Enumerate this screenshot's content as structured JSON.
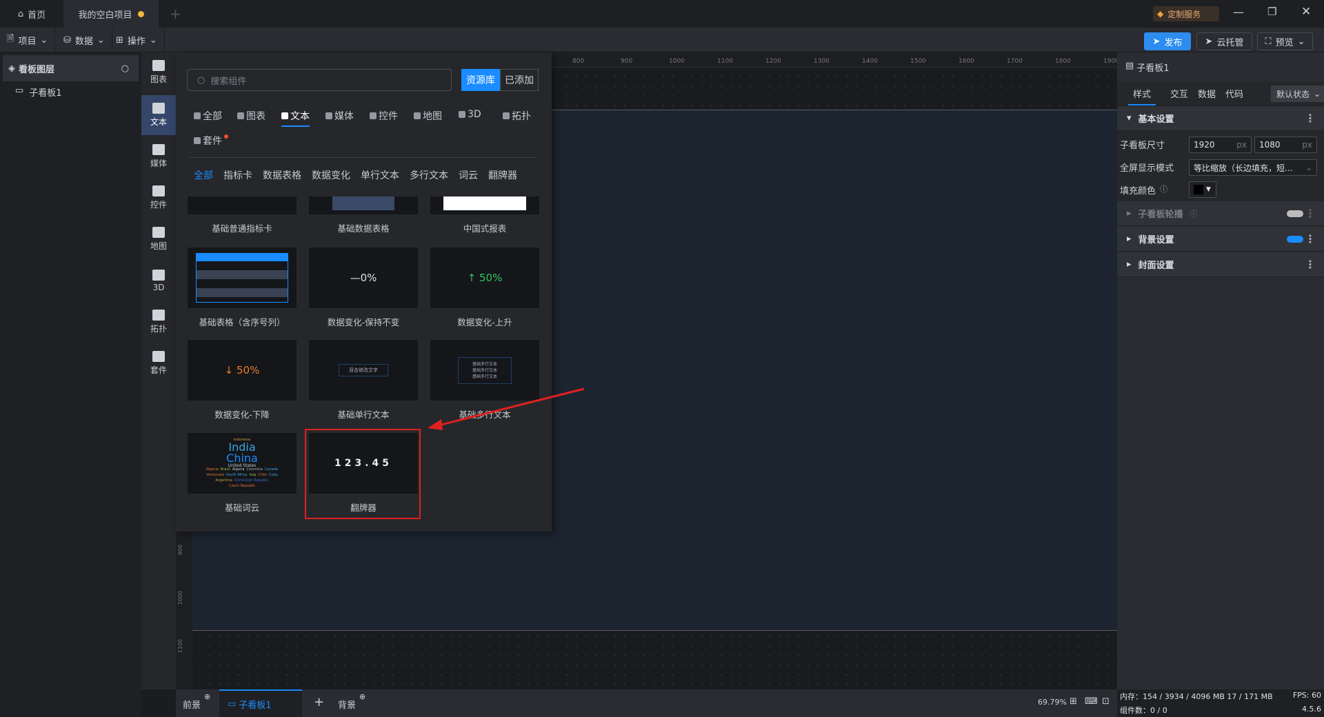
{
  "titlebar": {
    "home": "首页",
    "project_tab": "我的空白项目",
    "service": "定制服务"
  },
  "toolbar": {
    "menus": [
      "项目",
      "数据",
      "操作"
    ],
    "publish": "发布",
    "cloud": "云托管",
    "preview": "预览"
  },
  "layers": {
    "title": "看板图层",
    "items": [
      "子看板1"
    ]
  },
  "iconbar": [
    "图表",
    "文本",
    "媒体",
    "控件",
    "地图",
    "3D",
    "拓扑",
    "套件"
  ],
  "panel": {
    "search_placeholder": "搜索组件",
    "lib": "资源库",
    "added": "已添加",
    "categories": [
      "全部",
      "图表",
      "文本",
      "媒体",
      "控件",
      "地图",
      "3D",
      "拓扑",
      "套件"
    ],
    "active_category": "文本",
    "subcategories": [
      "全部",
      "指标卡",
      "数据表格",
      "数据变化",
      "单行文本",
      "多行文本",
      "词云",
      "翻牌器"
    ],
    "cards": [
      "基础普通指标卡",
      "基础数据表格",
      "中国式报表",
      "基础表格（含序号列）",
      "数据变化-保持不变",
      "数据变化-上升",
      "数据变化-下降",
      "基础单行文本",
      "基础多行文本",
      "基础词云",
      "翻牌器"
    ],
    "previews": {
      "flat": "—0%",
      "up": "↑ 50%",
      "down": "↓ 50%",
      "single": "双击修改文字",
      "multi": [
        "基础多行文本",
        "基础多行文本",
        "基础多行文本"
      ],
      "flip": "123.45",
      "cloud_big": [
        "India",
        "China"
      ],
      "cloud_small": [
        "Indonesia",
        "United States",
        "Nigeria",
        "Brazil",
        "Algeria",
        "Colombia",
        "Canada",
        "Venezuela",
        "South Africa",
        "Iraq",
        "Chile",
        "Cuba",
        "Argentina",
        "Dominican Republic",
        "Czech Republic"
      ]
    },
    "colors": {
      "up": "#2fc45f",
      "down": "#f07c2a",
      "highlight": "#e02020"
    }
  },
  "ruler": {
    "top": [
      "800",
      "900",
      "1000",
      "1100",
      "1200",
      "1300",
      "1400",
      "1500",
      "1600",
      "1700",
      "1800",
      "1900"
    ],
    "left": [
      "900",
      "1000",
      "1100"
    ]
  },
  "right": {
    "title": "子看板1",
    "tabs": [
      "样式",
      "交互",
      "数据",
      "代码"
    ],
    "state": "默认状态",
    "basic": "基本设置",
    "size_label": "子看板尺寸",
    "width": "1920",
    "height": "1080",
    "unit": "px",
    "mode_label": "全屏显示模式",
    "mode": "等比缩放（长边填充，短...",
    "fill_label": "填充颜色",
    "fill_color": "#000000",
    "carousel": "子看板轮播",
    "carousel_on": false,
    "bg": "背景设置",
    "bg_on": true,
    "cover": "封面设置"
  },
  "bottom": {
    "front": "前景",
    "board": "子看板1",
    "back": "背景",
    "zoom": "69.79%"
  },
  "status": {
    "memory": "内存：154 / 3934 / 4096 MB 17 / 171 MB",
    "fps": "FPS:  60",
    "count": "组件数：0 / 0",
    "version": "4.5.6"
  }
}
